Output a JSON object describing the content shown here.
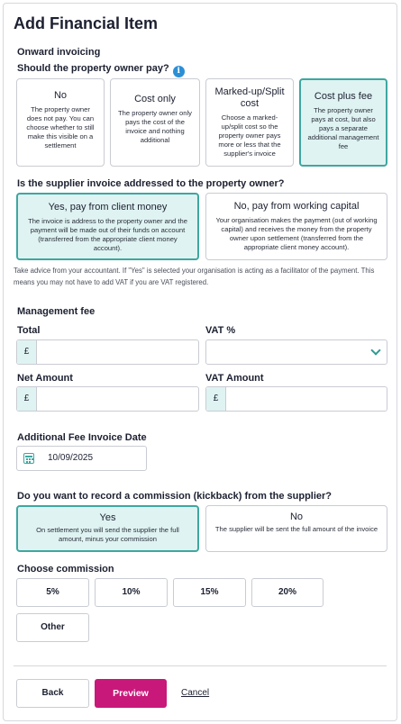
{
  "title": "Add Financial Item",
  "onward": {
    "heading": "Onward invoicing",
    "question": "Should the property owner pay?",
    "info_icon": "i",
    "options": [
      {
        "title": "No",
        "desc": "The property owner does not pay. You can choose whether to still make this visible on a settlement",
        "selected": false
      },
      {
        "title": "Cost only",
        "desc": "The property owner only pays the cost of the invoice and nothing additional",
        "selected": false
      },
      {
        "title": "Marked-up/Split cost",
        "desc": "Choose a marked-up/split cost so the property owner pays more or less that the supplier's invoice",
        "selected": false
      },
      {
        "title": "Cost plus fee",
        "desc": "The property owner pays at cost, but also pays a separate additional management fee",
        "selected": true
      }
    ]
  },
  "supplier": {
    "question": "Is the supplier invoice addressed to the property owner?",
    "options": [
      {
        "title": "Yes, pay from client money",
        "desc": "The invoice is address to the property owner and the payment will be made out of their funds on account (transferred from the appropriate client money account).",
        "selected": true
      },
      {
        "title": "No, pay from working capital",
        "desc": "Your organisation makes the payment (out of working capital) and receives the money from the property owner upon settlement (transferred from the appropriate client money account).",
        "selected": false
      }
    ],
    "note": "Take advice from your accountant. If \"Yes\" is selected your organisation is acting as a facilitator of the payment. This means you may not have to add VAT if you are VAT registered."
  },
  "management_fee": {
    "heading": "Management fee",
    "total_label": "Total",
    "total_prefix": "£",
    "total_value": "",
    "vat_label": "VAT %",
    "vat_value": "",
    "net_label": "Net Amount",
    "net_prefix": "£",
    "net_value": "",
    "vat_amount_label": "VAT Amount",
    "vat_amount_prefix": "£",
    "vat_amount_value": ""
  },
  "invoice_date": {
    "label": "Additional Fee Invoice Date",
    "value": "10/09/2025"
  },
  "commission": {
    "question": "Do you want to record a commission (kickback) from the supplier?",
    "options": [
      {
        "title": "Yes",
        "desc": "On settlement you will send the supplier the full amount, minus your commission",
        "selected": true
      },
      {
        "title": "No",
        "desc": "The supplier will be sent the full amount of the invoice",
        "selected": false
      }
    ],
    "choose_label": "Choose commission",
    "choices": [
      "5%",
      "10%",
      "15%",
      "20%",
      "Other"
    ]
  },
  "actions": {
    "back": "Back",
    "preview": "Preview",
    "cancel": "Cancel"
  },
  "colors": {
    "accent": "#3ea7a0",
    "selected_bg": "#dff3f2",
    "primary": "#c8187a",
    "info": "#2b8fd6"
  }
}
